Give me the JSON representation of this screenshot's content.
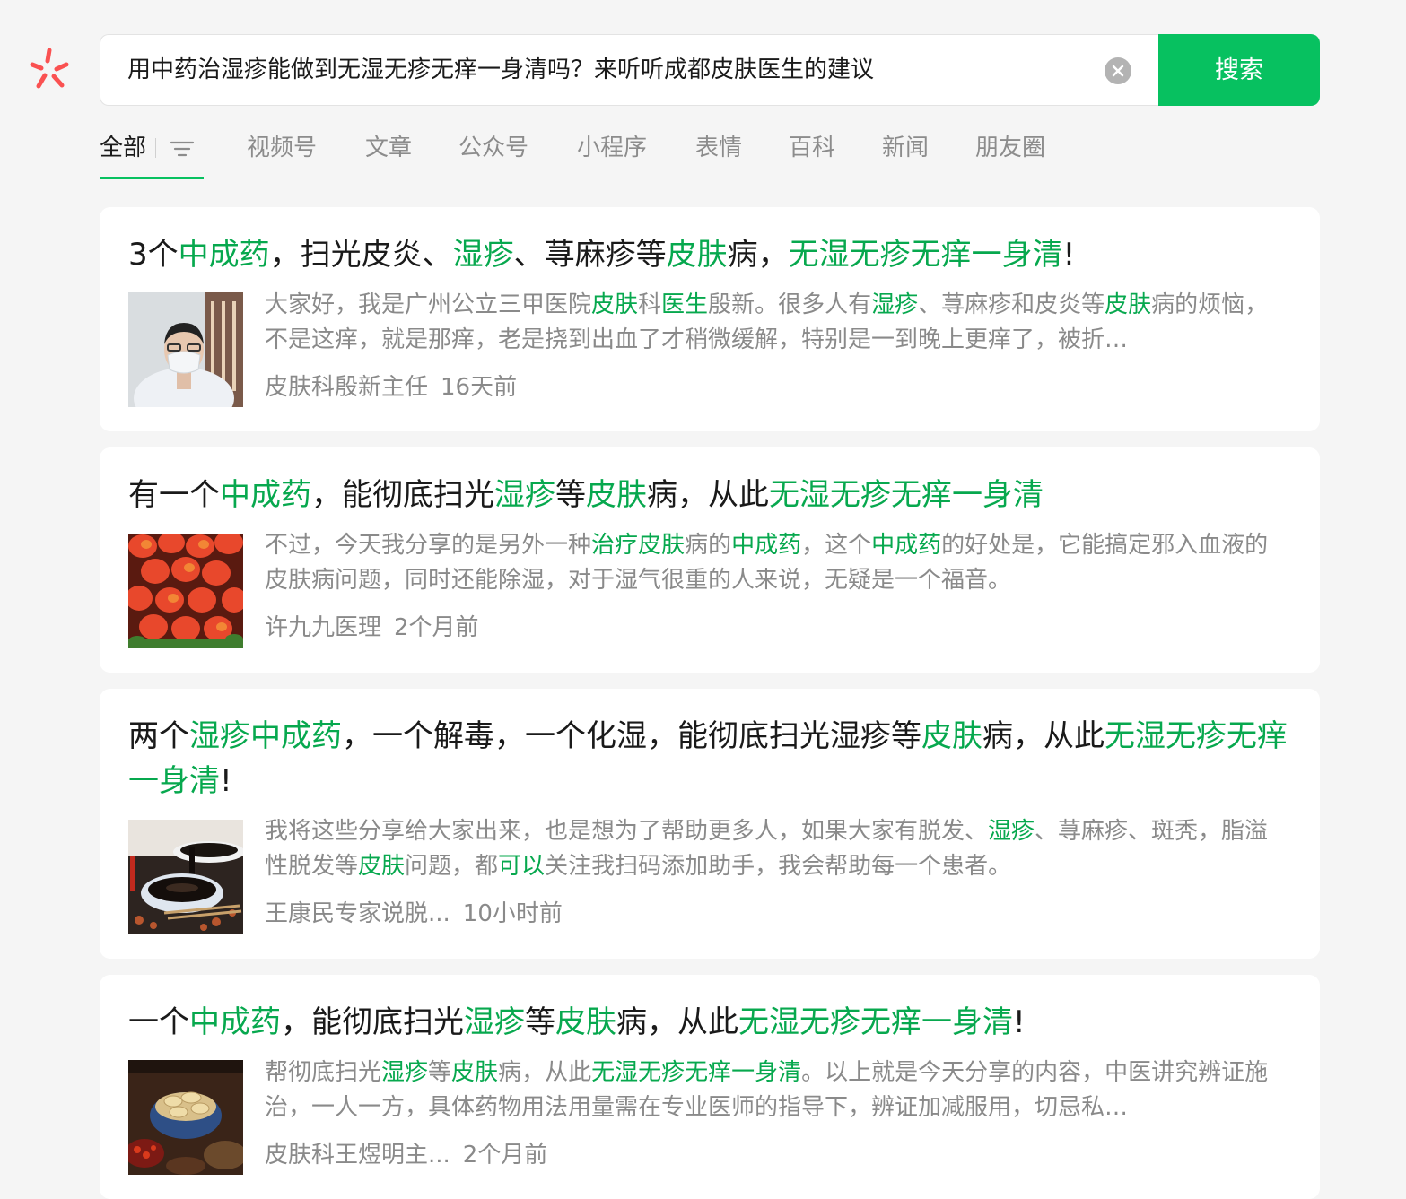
{
  "search": {
    "query": "用中药治湿疹能做到无湿无疹无痒一身清吗？来听听成都皮肤医生的建议",
    "button_label": "搜索",
    "clear_icon": "clear-icon"
  },
  "colors": {
    "accent": "#07c160",
    "highlight": "#07a84e",
    "logo": "#fa5151"
  },
  "tabs": [
    {
      "label": "全部",
      "active": true
    },
    {
      "label": "视频号"
    },
    {
      "label": "文章"
    },
    {
      "label": "公众号"
    },
    {
      "label": "小程序"
    },
    {
      "label": "表情"
    },
    {
      "label": "百科"
    },
    {
      "label": "新闻"
    },
    {
      "label": "朋友圈"
    }
  ],
  "results": [
    {
      "title": [
        {
          "t": "3个"
        },
        {
          "t": "中成药",
          "hl": true
        },
        {
          "t": "，扫光皮炎、"
        },
        {
          "t": "湿疹",
          "hl": true
        },
        {
          "t": "、荨麻疹等"
        },
        {
          "t": "皮肤",
          "hl": true
        },
        {
          "t": "病，"
        },
        {
          "t": "无湿无疹无痒一身清",
          "hl": true
        },
        {
          "t": "!"
        }
      ],
      "snippet": [
        {
          "t": "大家好，我是广州公立三甲医院"
        },
        {
          "t": "皮肤",
          "hl": true
        },
        {
          "t": "科"
        },
        {
          "t": "医生",
          "hl": true
        },
        {
          "t": "殷新。很多人有"
        },
        {
          "t": "湿疹",
          "hl": true
        },
        {
          "t": "、荨麻疹和皮炎等"
        },
        {
          "t": "皮肤",
          "hl": true
        },
        {
          "t": "病的烦恼，不是这痒，就是那痒，老是挠到出血了才稍微缓解，特别是一到晚上更痒了，被折…"
        }
      ],
      "source": "皮肤科殷新主任",
      "time": "16天前",
      "thumb": "doctor-photo"
    },
    {
      "title": [
        {
          "t": "有一个"
        },
        {
          "t": "中成药",
          "hl": true
        },
        {
          "t": "，能彻底扫光"
        },
        {
          "t": "湿疹",
          "hl": true
        },
        {
          "t": "等"
        },
        {
          "t": "皮肤",
          "hl": true
        },
        {
          "t": "病，从此"
        },
        {
          "t": "无湿无疹无痒一身清",
          "hl": true
        }
      ],
      "snippet": [
        {
          "t": "不过，今天我分享的是另外一种"
        },
        {
          "t": "治疗",
          "hl": true
        },
        {
          "t": "皮肤",
          "hl": true
        },
        {
          "t": "病的"
        },
        {
          "t": "中成药",
          "hl": true
        },
        {
          "t": "，这个"
        },
        {
          "t": "中成药",
          "hl": true
        },
        {
          "t": "的好处是，它能搞定邪入血液的皮肤病问题，同时还能除湿，对于湿气很重的人来说，无疑是一个福音。"
        }
      ],
      "source": "许九九医理",
      "time": "2个月前",
      "thumb": "tulips-photo"
    },
    {
      "title": [
        {
          "t": "两个"
        },
        {
          "t": "湿疹",
          "hl": true
        },
        {
          "t": "中成药",
          "hl": true
        },
        {
          "t": "，一个解毒，一个化湿，能彻底扫光湿疹等"
        },
        {
          "t": "皮肤",
          "hl": true
        },
        {
          "t": "病，从此"
        },
        {
          "t": "无湿无疹无痒一身清",
          "hl": true
        },
        {
          "t": "!"
        }
      ],
      "snippet": [
        {
          "t": "我将这些分享给大家出来，也是想为了帮助更多人，如果大家有脱发、"
        },
        {
          "t": "湿疹",
          "hl": true
        },
        {
          "t": "、荨麻疹、斑秃，脂溢性脱发等"
        },
        {
          "t": "皮肤",
          "hl": true
        },
        {
          "t": "问题，都"
        },
        {
          "t": "可以",
          "hl": true
        },
        {
          "t": "关注我扫码添加助手，我会帮助每一个患者。"
        }
      ],
      "source": "王康民专家说脱...",
      "time": "10小时前",
      "thumb": "herbal-paste-photo"
    },
    {
      "title": [
        {
          "t": "一个"
        },
        {
          "t": "中成药",
          "hl": true
        },
        {
          "t": "，能彻底扫光"
        },
        {
          "t": "湿疹",
          "hl": true
        },
        {
          "t": "等"
        },
        {
          "t": "皮肤",
          "hl": true
        },
        {
          "t": "病，从此"
        },
        {
          "t": "无湿无疹无痒一身清",
          "hl": true
        },
        {
          "t": "!"
        }
      ],
      "snippet": [
        {
          "t": "帮彻底扫光"
        },
        {
          "t": "湿疹",
          "hl": true
        },
        {
          "t": "等"
        },
        {
          "t": "皮肤",
          "hl": true
        },
        {
          "t": "病，从此"
        },
        {
          "t": "无湿无疹无痒一身清",
          "hl": true
        },
        {
          "t": "。以上就是今天分享的内容，中医讲究辨证施治，一人一方，具体药物用法用量需在专业医师的指导下，辨证加减服用，切忌私…"
        }
      ],
      "source": "皮肤科王煜明主...",
      "time": "2个月前",
      "thumb": "herb-slices-photo"
    }
  ]
}
